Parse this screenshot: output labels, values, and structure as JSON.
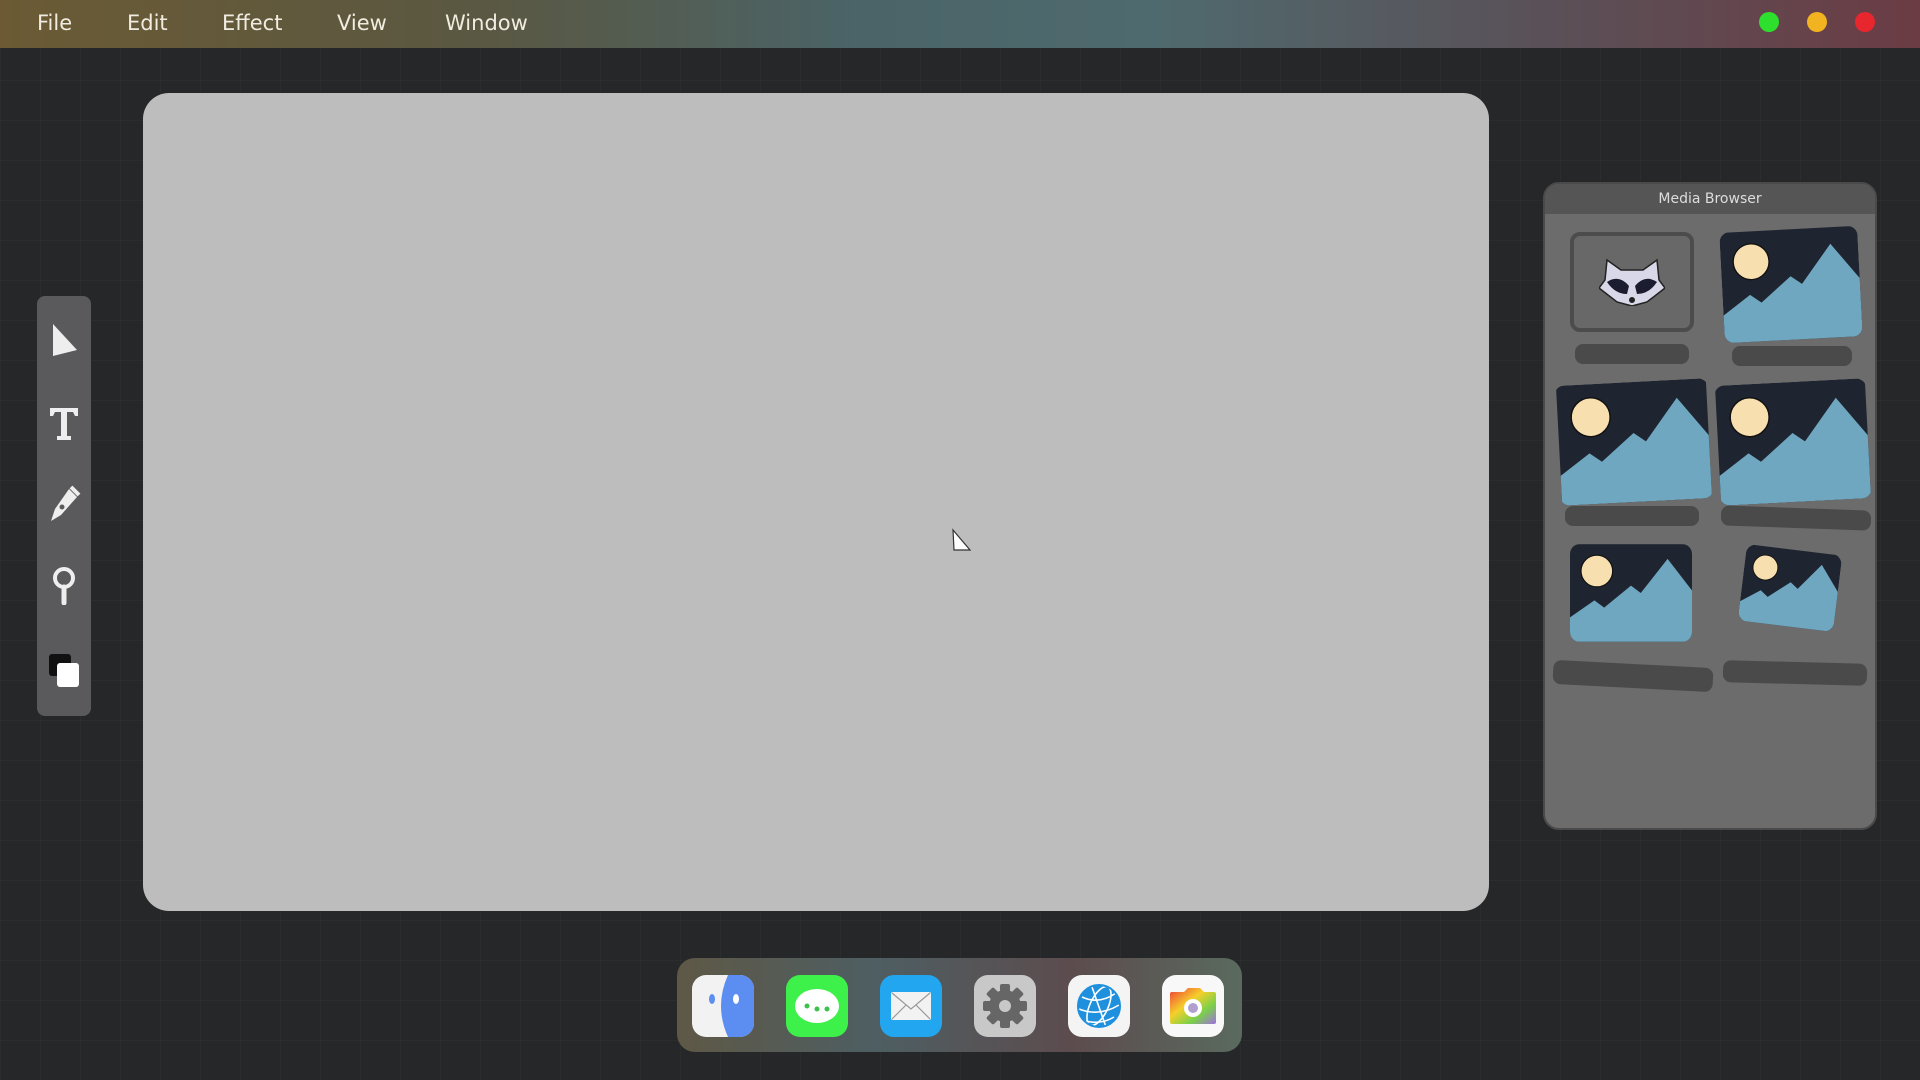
{
  "menubar": {
    "items": [
      "File",
      "Edit",
      "Effect",
      "View",
      "Window"
    ],
    "window_controls": [
      {
        "name": "green",
        "color": "#2ee02e"
      },
      {
        "name": "yellow",
        "color": "#f2b320"
      },
      {
        "name": "red",
        "color": "#e8262e"
      }
    ]
  },
  "toolbar": {
    "tools": [
      "select-arrow-icon",
      "text-tool-icon",
      "pen-tool-icon",
      "zoom-tool-icon",
      "color-swatch-icon"
    ]
  },
  "media_browser": {
    "title": "Media Browser",
    "items": [
      "raccoon-image",
      "landscape-image",
      "landscape-image",
      "landscape-image",
      "landscape-image",
      "landscape-image"
    ]
  },
  "dock": {
    "apps": [
      "finder",
      "messages",
      "mail",
      "settings",
      "browser",
      "camera"
    ]
  },
  "colors": {
    "canvas": "#bdbdbd",
    "thumb_bg": "#1f2530",
    "sun": "#f7dfb0",
    "mountain": "#6fa7c0"
  }
}
